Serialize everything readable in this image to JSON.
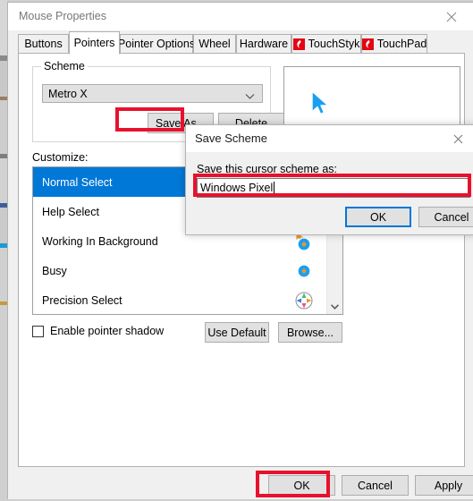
{
  "window": {
    "title": "Mouse Properties",
    "close_icon": "close-icon"
  },
  "tabs": [
    {
      "label": "Buttons",
      "selected": false,
      "icon": null
    },
    {
      "label": "Pointers",
      "selected": true,
      "icon": null
    },
    {
      "label": "Pointer Options",
      "selected": false,
      "icon": null
    },
    {
      "label": "Wheel",
      "selected": false,
      "icon": null
    },
    {
      "label": "Hardware",
      "selected": false,
      "icon": null
    },
    {
      "label": "TouchStyk",
      "selected": false,
      "icon": "touchstyk-brand-icon"
    },
    {
      "label": "TouchPad",
      "selected": false,
      "icon": "touchpad-brand-icon"
    }
  ],
  "scheme": {
    "legend": "Scheme",
    "selected_value": "Metro X",
    "dropdown_icon": "chevron-down-icon",
    "save_as_label": "Save As...",
    "delete_label": "Delete"
  },
  "customize": {
    "label": "Customize:",
    "rows": [
      {
        "label": "Normal Select",
        "selected": true,
        "icon": "normal-select-cursor"
      },
      {
        "label": "Help Select",
        "selected": false,
        "icon": "help-select-cursor"
      },
      {
        "label": "Working In Background",
        "selected": false,
        "icon": "working-in-background-cursor"
      },
      {
        "label": "Busy",
        "selected": false,
        "icon": "busy-cursor"
      },
      {
        "label": "Precision Select",
        "selected": false,
        "icon": "precision-select-cursor"
      }
    ],
    "scroll_down_icon": "chevron-down-icon"
  },
  "options": {
    "enable_pointer_shadow_label": "Enable pointer shadow",
    "enable_pointer_shadow_checked": false,
    "use_default_label": "Use Default",
    "browse_label": "Browse..."
  },
  "preview": {
    "cursor_icon": "normal-select-cursor-preview"
  },
  "main_buttons": {
    "ok_label": "OK",
    "cancel_label": "Cancel",
    "apply_label": "Apply"
  },
  "save_scheme_dialog": {
    "title": "Save Scheme",
    "close_icon": "close-icon",
    "prompt": "Save this cursor scheme as:",
    "input_value": "Windows Pixel",
    "input_placeholder": "",
    "ok_label": "OK",
    "cancel_label": "Cancel"
  },
  "annotations": {
    "highlight_color": "#e8112d",
    "focus_color": "#0078d7",
    "accent_color": "#0078d7",
    "targets": [
      "save-as-button",
      "scheme-name-input",
      "main-ok-button"
    ]
  }
}
